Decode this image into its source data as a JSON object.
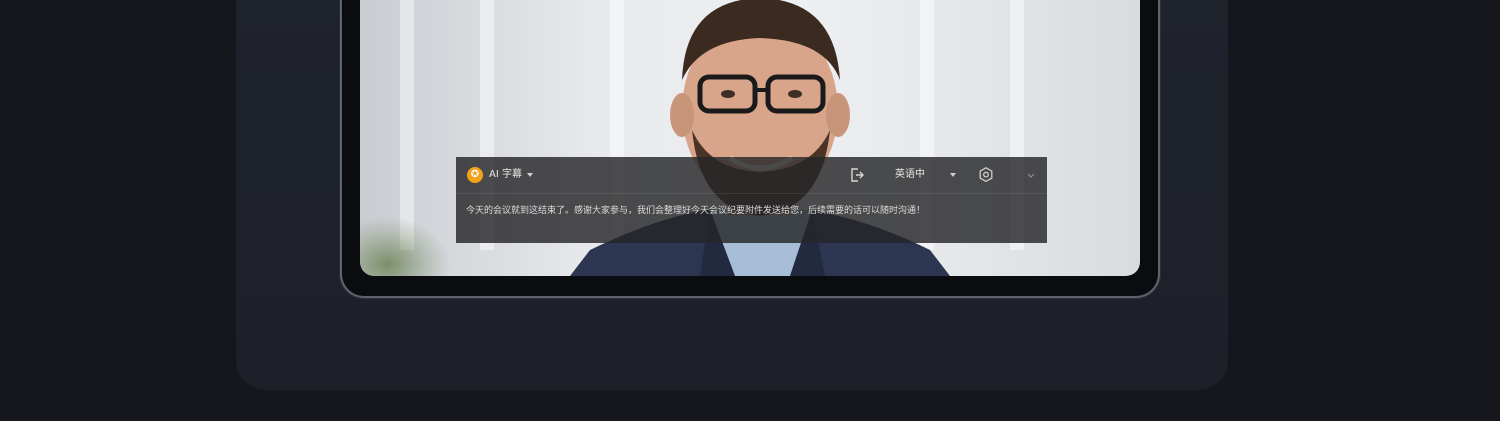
{
  "caption_panel": {
    "title": "AI 字幕",
    "language": "英语中",
    "text": "今天的会议就到这结束了。感谢大家参与，我们会整理好今天会议纪要附件发送给您，后续需要的话可以随时沟通！"
  },
  "icons": {
    "logo": "ai-logo-icon",
    "title_dropdown": "chevron-down-icon",
    "exit": "exit-icon",
    "language_dropdown": "chevron-down-icon",
    "settings": "gear-icon",
    "collapse": "chevron-down-icon"
  },
  "colors": {
    "background": "#16161d",
    "card": "#1f232c",
    "logo_accent": "#f2a31a",
    "caption_background": "#262628"
  }
}
